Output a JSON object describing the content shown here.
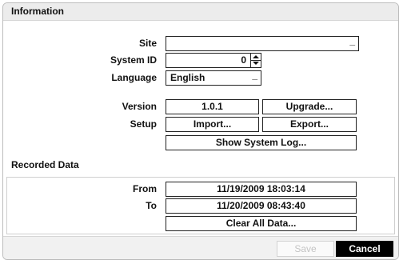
{
  "header": {
    "title": "Information"
  },
  "info": {
    "site_label": "Site",
    "site_value": "",
    "site_dropdown_marker": "_",
    "system_id_label": "System ID",
    "system_id_value": "0",
    "language_label": "Language",
    "language_value": "English",
    "language_dropdown_marker": "_",
    "version_label": "Version",
    "version_value": "1.0.1",
    "upgrade_label": "Upgrade...",
    "setup_label": "Setup",
    "import_label": "Import...",
    "export_label": "Export...",
    "show_log_label": "Show System Log..."
  },
  "recorded": {
    "title": "Recorded Data",
    "from_label": "From",
    "from_value": "11/19/2009  18:03:14",
    "to_label": "To",
    "to_value": "11/20/2009  08:43:40",
    "clear_label": "Clear All Data..."
  },
  "footer": {
    "save_label": "Save",
    "cancel_label": "Cancel"
  },
  "icons": {
    "spinner_up": "spinner-up-icon",
    "spinner_down": "spinner-down-icon"
  }
}
